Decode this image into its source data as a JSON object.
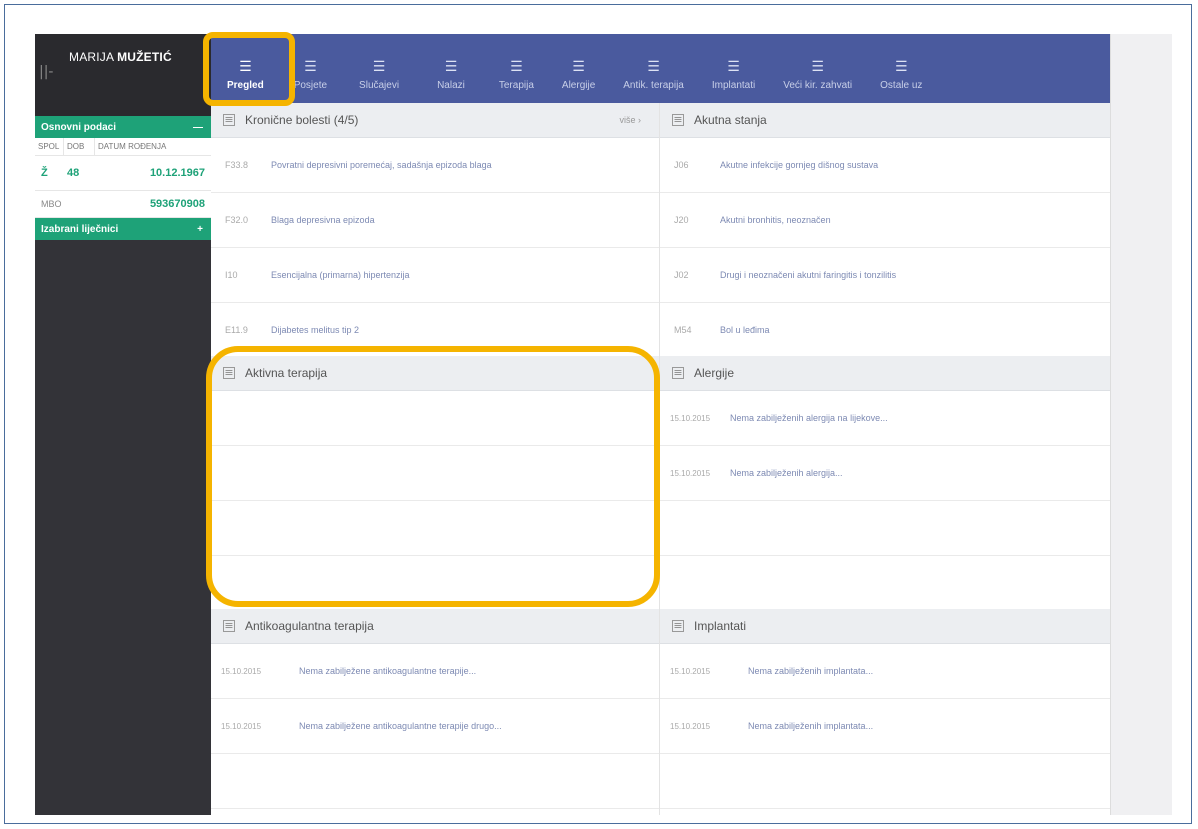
{
  "patient": {
    "first_name": "MARIJA",
    "last_name": "MUŽETIĆ"
  },
  "sidebar": {
    "handle": "||-",
    "basic_section": {
      "label": "Osnovni podaci",
      "toggle": "—"
    },
    "info_headers": [
      "SPOL",
      "DOB",
      "DATUM ROĐENJA"
    ],
    "info_values": {
      "sex": "Ž",
      "age": "48",
      "birthdate": "10.12.1967"
    },
    "mbo": {
      "label": "MBO",
      "value": "593670908"
    },
    "doctors_section": {
      "label": "Izabrani liječnici",
      "toggle": "+"
    }
  },
  "nav": {
    "icon": "list-icon",
    "items": [
      {
        "label": "Pregled",
        "active": true
      },
      {
        "label": "Posjete"
      },
      {
        "label": "Slučajevi"
      },
      {
        "label": "Nalazi"
      },
      {
        "label": "Terapija"
      },
      {
        "label": "Alergije"
      },
      {
        "label": "Antik. terapija"
      },
      {
        "label": "Implantati"
      },
      {
        "label": "Veći kir. zahvati"
      },
      {
        "label": "Ostale uz"
      }
    ]
  },
  "panels": {
    "chronic": {
      "title": "Kronične bolesti (4/5)",
      "more": "više ›",
      "rows": [
        {
          "code": "F33.8",
          "text": "Povratni depresivni poremećaj, sadašnja epizoda blaga"
        },
        {
          "code": "F32.0",
          "text": "Blaga depresivna epizoda"
        },
        {
          "code": "I10",
          "text": "Esencijalna (primarna) hipertenzija"
        },
        {
          "code": "E11.9",
          "text": "Dijabetes melitus tip 2"
        }
      ]
    },
    "acute": {
      "title": "Akutna stanja",
      "rows": [
        {
          "code": "J06",
          "text": "Akutne infekcije gornjeg dišnog sustava"
        },
        {
          "code": "J20",
          "text": "Akutni bronhitis, neoznačen"
        },
        {
          "code": "J02",
          "text": "Drugi i neoznačeni akutni faringitis i tonzilitis"
        },
        {
          "code": "M54",
          "text": "Bol u leđima"
        }
      ]
    },
    "active_therapy": {
      "title": "Aktivna terapija"
    },
    "allergies": {
      "title": "Alergije",
      "rows": [
        {
          "date": "15.10.2015",
          "text": "Nema zabilježenih alergija na lijekove..."
        },
        {
          "date": "15.10.2015",
          "text": "Nema zabilježenih alergija..."
        }
      ]
    },
    "anticoag": {
      "title": "Antikoagulantna terapija",
      "rows": [
        {
          "date": "15.10.2015",
          "text": "Nema zabilježene antikoagulantne terapije..."
        },
        {
          "date": "15.10.2015",
          "text": "Nema zabilježene antikoagulantne terapije drugo..."
        }
      ]
    },
    "implants": {
      "title": "Implantati",
      "rows": [
        {
          "date": "15.10.2015",
          "text": "Nema zabilježenih implantata..."
        },
        {
          "date": "15.10.2015",
          "text": "Nema zabilježenih implantata..."
        }
      ]
    }
  },
  "colors": {
    "nav_bg": "#4a5a9e",
    "accent_green": "#1ea278",
    "highlight": "#f5b400",
    "sidebar_bg": "#333338"
  }
}
